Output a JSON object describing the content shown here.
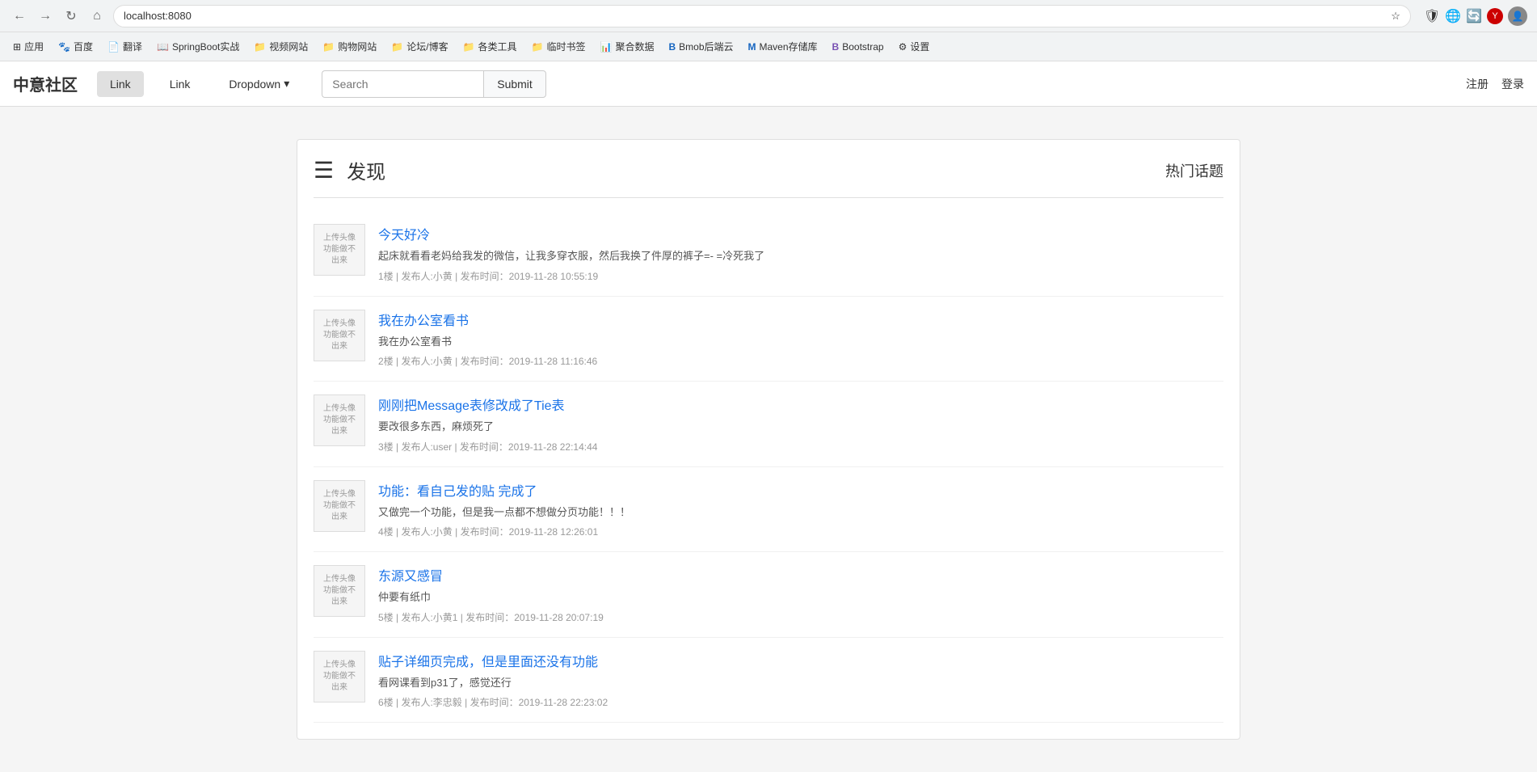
{
  "browser": {
    "url": "localhost:8080",
    "nav": {
      "back": "◀",
      "forward": "▶",
      "refresh": "↻",
      "home": "⌂"
    }
  },
  "bookmarks": [
    {
      "id": "apps",
      "label": "应用",
      "icon": "⊞"
    },
    {
      "id": "baidu",
      "label": "百度",
      "icon": "🐾"
    },
    {
      "id": "translate",
      "label": "翻译",
      "icon": "📄"
    },
    {
      "id": "springboot",
      "label": "SpringBoot实战",
      "icon": "📖"
    },
    {
      "id": "video",
      "label": "视频网站",
      "icon": "📁"
    },
    {
      "id": "shop",
      "label": "购物网站",
      "icon": "📁"
    },
    {
      "id": "forum",
      "label": "论坛/博客",
      "icon": "📁"
    },
    {
      "id": "tools",
      "label": "各类工具",
      "icon": "📁"
    },
    {
      "id": "bookmark",
      "label": "临时书签",
      "icon": "📁"
    },
    {
      "id": "juheshuju",
      "label": "聚合数据",
      "icon": "📊"
    },
    {
      "id": "bmob",
      "label": "Bmob后端云",
      "icon": "B"
    },
    {
      "id": "maven",
      "label": "Maven存储库",
      "icon": "M"
    },
    {
      "id": "bootstrap",
      "label": "Bootstrap",
      "icon": "B"
    },
    {
      "id": "settings",
      "label": "设置",
      "icon": "⚙"
    }
  ],
  "navbar": {
    "brand": "中意社区",
    "links": [
      {
        "id": "link1",
        "label": "Link",
        "active": true
      },
      {
        "id": "link2",
        "label": "Link",
        "active": false
      }
    ],
    "dropdown": {
      "label": "Dropdown",
      "arrow": "▾"
    },
    "search": {
      "placeholder": "Search",
      "button_label": "Submit"
    },
    "right_links": [
      {
        "id": "register",
        "label": "注册"
      },
      {
        "id": "login",
        "label": "登录"
      }
    ]
  },
  "page": {
    "title": "发现",
    "hot_topics": "热门话题",
    "list_icon": "≡"
  },
  "posts": [
    {
      "id": 1,
      "avatar_text": "上传头像\n功能做不\n出来",
      "title": "今天好冷",
      "summary": "起床就看看老妈给我发的微信，让我多穿衣服，然后我换了件厚的裤子=- =冷死我了",
      "meta": "1楼 | 发布人:小黄 | 发布时间：2019-11-28 10:55:19"
    },
    {
      "id": 2,
      "avatar_text": "上传头像\n功能做不\n出来",
      "title": "我在办公室看书",
      "summary": "我在办公室看书",
      "meta": "2楼 | 发布人:小黄 | 发布时间：2019-11-28 11:16:46"
    },
    {
      "id": 3,
      "avatar_text": "上传头像\n功能做不\n出来",
      "title": "刚刚把Message表修改成了Tie表",
      "summary": "要改很多东西，麻烦死了",
      "meta": "3楼 | 发布人:user | 发布时间：2019-11-28 22:14:44"
    },
    {
      "id": 4,
      "avatar_text": "上传头像\n功能做不\n出来",
      "title": "功能：看自己发的贴 完成了",
      "summary": "又做完一个功能，但是我一点都不想做分页功能！！！",
      "meta": "4楼 | 发布人:小黄 | 发布时间：2019-11-28 12:26:01"
    },
    {
      "id": 5,
      "avatar_text": "上传头像\n功能做不\n出来",
      "title": "东源又感冒",
      "summary": "仲要有纸巾",
      "meta": "5楼 | 发布人:小黄1 | 发布时间：2019-11-28 20:07:19"
    },
    {
      "id": 6,
      "avatar_text": "上传头像\n功能做不\n出来",
      "title": "贴子详细页完成，但是里面还没有功能",
      "summary": "看网课看到p31了，感觉还行",
      "meta": "6楼 | 发布人:李忠毅 | 发布时间：2019-11-28 22:23:02"
    }
  ]
}
